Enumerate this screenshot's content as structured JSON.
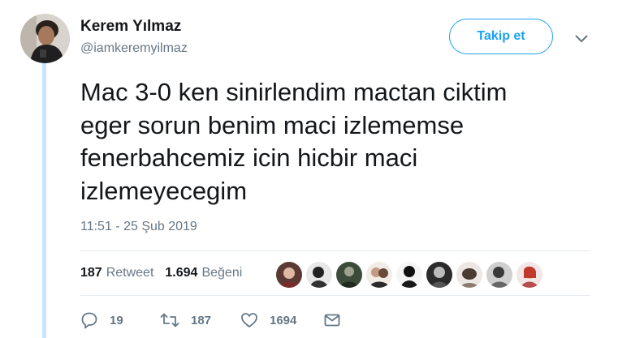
{
  "user": {
    "name": "Kerem Yılmaz",
    "handle": "@iamkeremyilmaz"
  },
  "header": {
    "follow_label": "Takip et"
  },
  "tweet": {
    "text": "Mac 3-0 ken sinirlendim mactan ciktim\neger sorun benim maci izlememse\nfenerbahcemiz icin hicbir maci\nizlemeyecegim",
    "timestamp": "11:51 - 25 Şub 2019"
  },
  "stats": {
    "retweets": "187",
    "retweets_label": "Retweet",
    "likes": "1.694",
    "likes_label": "Beğeni"
  },
  "actions": {
    "replies": "19",
    "retweets": "187",
    "likes": "1694"
  },
  "colors": {
    "accent": "#1da1f2",
    "thread_line": "#c7e5fb",
    "muted": "#657786",
    "text": "#14171a"
  },
  "icons": {
    "caret": "chevron-down-icon",
    "reply": "reply-icon",
    "retweet": "retweet-icon",
    "like": "heart-icon",
    "message": "envelope-icon"
  }
}
